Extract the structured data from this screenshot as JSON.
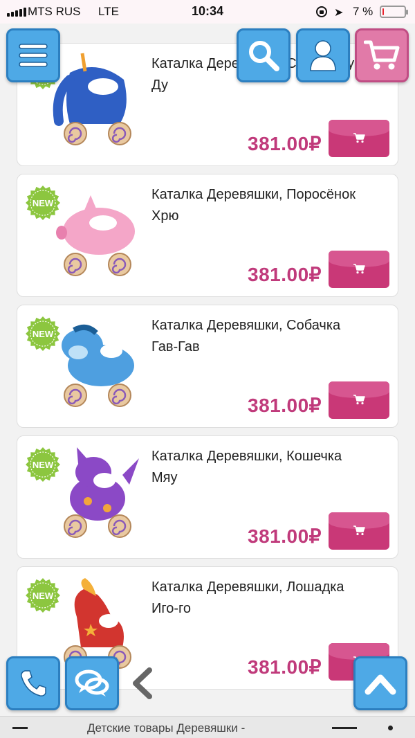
{
  "status_bar": {
    "carrier": "MTS RUS",
    "network": "LTE",
    "time": "10:34",
    "battery": "7 %",
    "battery_level": 0.07
  },
  "products": [
    {
      "title": "Каталка Деревяшки, Слоник Ду-Ду",
      "price": "381.00₽",
      "new": true,
      "toy": "elephant",
      "colors": {
        "body": "#2f5fc4",
        "accent": "#ffffff"
      }
    },
    {
      "title": "Каталка Деревяшки, Поросёнок Хрю",
      "price": "381.00₽",
      "new": true,
      "toy": "pig",
      "colors": {
        "body": "#f4a6c8",
        "accent": "#ffffff"
      }
    },
    {
      "title": "Каталка Деревяшки, Собачка Гав-Гав",
      "price": "381.00₽",
      "new": true,
      "toy": "dog",
      "colors": {
        "body": "#4e9fe0",
        "accent": "#bfe1f7"
      }
    },
    {
      "title": "Каталка Деревяшки, Кошечка Мяу",
      "price": "381.00₽",
      "new": true,
      "toy": "cat",
      "colors": {
        "body": "#8b49c6",
        "accent": "#f2a63b"
      }
    },
    {
      "title": "Каталка Деревяшки, Лошадка Иго-го",
      "price": "381.00₽",
      "new": true,
      "toy": "horse",
      "colors": {
        "body": "#d2352f",
        "accent": "#f4b03a"
      }
    }
  ],
  "badge_text": "NEW",
  "icons": {
    "menu": "hamburger-icon",
    "search": "search-icon",
    "account": "user-icon",
    "cart": "cart-icon",
    "phone": "phone-icon",
    "chat": "chat-icon",
    "back": "chevron-left-icon",
    "scroll_top": "chevron-up-icon"
  },
  "colors": {
    "accent": "#c93877",
    "price": "#c03a7b",
    "fab_blue": "#4ea9e6",
    "fab_pink": "#e17aa8",
    "badge_green": "#8cc63f"
  },
  "bottom_bar": {
    "page_title": "Детские товары Деревяшки - "
  }
}
